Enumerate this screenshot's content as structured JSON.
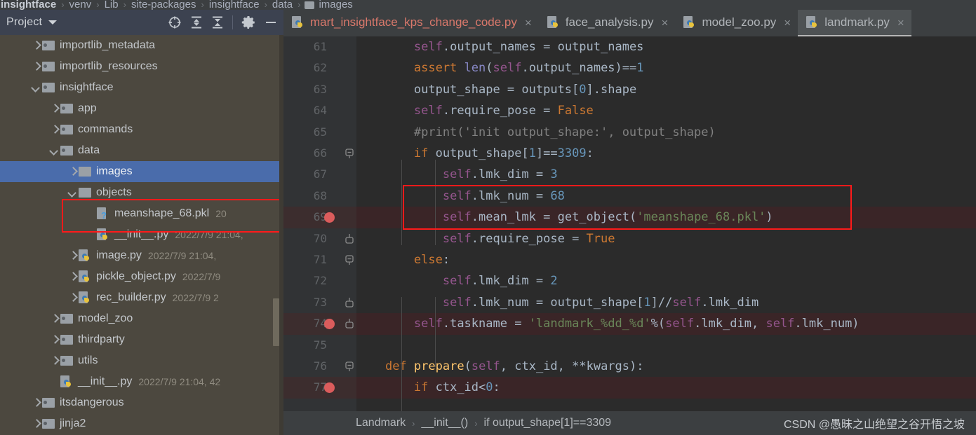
{
  "breadcrumb": {
    "segments": [
      "insightface",
      "venv",
      "Lib",
      "site-packages",
      "insightface",
      "data",
      "images"
    ],
    "separator": "›"
  },
  "project_panel": {
    "title": "Project",
    "toolbar_icons": [
      "locate-icon",
      "expand-all-icon",
      "collapse-all-icon",
      "gear-icon",
      "hide-icon"
    ],
    "tree": [
      {
        "indent": 1,
        "arrow": "right",
        "icon": "folder-icon",
        "label": "importlib_metadata",
        "meta": "",
        "selected": false
      },
      {
        "indent": 1,
        "arrow": "right",
        "icon": "folder-icon",
        "label": "importlib_resources",
        "meta": "",
        "selected": false
      },
      {
        "indent": 1,
        "arrow": "down",
        "icon": "folder-icon",
        "label": "insightface",
        "meta": "",
        "selected": false
      },
      {
        "indent": 2,
        "arrow": "right",
        "icon": "folder-icon",
        "label": "app",
        "meta": "",
        "selected": false
      },
      {
        "indent": 2,
        "arrow": "right",
        "icon": "folder-icon",
        "label": "commands",
        "meta": "",
        "selected": false
      },
      {
        "indent": 2,
        "arrow": "down",
        "icon": "folder-icon",
        "label": "data",
        "meta": "",
        "selected": false
      },
      {
        "indent": 3,
        "arrow": "right",
        "icon": "folder-plain-icon",
        "label": "images",
        "meta": "",
        "selected": true
      },
      {
        "indent": 3,
        "arrow": "down",
        "icon": "folder-plain-icon",
        "label": "objects",
        "meta": "",
        "selected": false
      },
      {
        "indent": 4,
        "arrow": "none",
        "icon": "pkl-file-icon",
        "label": "meanshape_68.pkl",
        "meta": "20",
        "selected": false
      },
      {
        "indent": 4,
        "arrow": "none",
        "icon": "python-file-icon",
        "label": "__init__.py",
        "meta": "2022/7/9 21:04,",
        "selected": false
      },
      {
        "indent": 3,
        "arrow": "right",
        "icon": "python-file-icon",
        "label": "image.py",
        "meta": "2022/7/9 21:04,",
        "selected": false
      },
      {
        "indent": 3,
        "arrow": "right",
        "icon": "python-file-icon",
        "label": "pickle_object.py",
        "meta": "2022/7/9",
        "selected": false
      },
      {
        "indent": 3,
        "arrow": "right",
        "icon": "python-file-icon",
        "label": "rec_builder.py",
        "meta": "2022/7/9 2",
        "selected": false
      },
      {
        "indent": 2,
        "arrow": "right",
        "icon": "folder-icon",
        "label": "model_zoo",
        "meta": "",
        "selected": false
      },
      {
        "indent": 2,
        "arrow": "right",
        "icon": "folder-icon",
        "label": "thirdparty",
        "meta": "",
        "selected": false
      },
      {
        "indent": 2,
        "arrow": "right",
        "icon": "folder-icon",
        "label": "utils",
        "meta": "",
        "selected": false
      },
      {
        "indent": 2,
        "arrow": "none",
        "icon": "python-file-icon",
        "label": "__init__.py",
        "meta": "2022/7/9 21:04, 42",
        "selected": false
      },
      {
        "indent": 1,
        "arrow": "right",
        "icon": "folder-icon",
        "label": "itsdangerous",
        "meta": "",
        "selected": false
      },
      {
        "indent": 1,
        "arrow": "right",
        "icon": "folder-icon",
        "label": "jinja2",
        "meta": "",
        "selected": false
      }
    ]
  },
  "editor": {
    "tabs": [
      {
        "label": "mart_insightface_kps_change_code.py",
        "icon": "python-file-icon",
        "close": "×",
        "active": false,
        "modified": true
      },
      {
        "label": "face_analysis.py",
        "icon": "python-file-icon",
        "close": "×",
        "active": false,
        "modified": false
      },
      {
        "label": "model_zoo.py",
        "icon": "python-file-icon",
        "close": "×",
        "active": false,
        "modified": false
      },
      {
        "label": "landmark.py",
        "icon": "python-file-icon",
        "close": "×",
        "active": true,
        "modified": false
      }
    ],
    "lines": [
      {
        "num": "61",
        "breakpoint": false,
        "highlight": false,
        "fold": "none",
        "tokens": [
          {
            "t": "        ",
            "c": ""
          },
          {
            "t": "self",
            "c": "t-self"
          },
          {
            "t": ".output_names = output_names",
            "c": ""
          }
        ]
      },
      {
        "num": "62",
        "breakpoint": false,
        "highlight": false,
        "fold": "none",
        "tokens": [
          {
            "t": "        ",
            "c": ""
          },
          {
            "t": "assert",
            "c": "t-kw"
          },
          {
            "t": " ",
            "c": ""
          },
          {
            "t": "len",
            "c": "t-builtin"
          },
          {
            "t": "(",
            "c": ""
          },
          {
            "t": "self",
            "c": "t-self"
          },
          {
            "t": ".output_names)==",
            "c": ""
          },
          {
            "t": "1",
            "c": "t-num"
          }
        ]
      },
      {
        "num": "63",
        "breakpoint": false,
        "highlight": false,
        "fold": "none",
        "tokens": [
          {
            "t": "        output_shape = outputs[",
            "c": ""
          },
          {
            "t": "0",
            "c": "t-num"
          },
          {
            "t": "].shape",
            "c": ""
          }
        ]
      },
      {
        "num": "64",
        "breakpoint": false,
        "highlight": false,
        "fold": "none",
        "tokens": [
          {
            "t": "        ",
            "c": ""
          },
          {
            "t": "self",
            "c": "t-self"
          },
          {
            "t": ".require_pose = ",
            "c": ""
          },
          {
            "t": "False",
            "c": "t-kw"
          }
        ]
      },
      {
        "num": "65",
        "breakpoint": false,
        "highlight": false,
        "fold": "none",
        "tokens": [
          {
            "t": "        #print('init output_shape:', output_shape)",
            "c": "t-cmt"
          }
        ]
      },
      {
        "num": "66",
        "breakpoint": false,
        "highlight": false,
        "fold": "open",
        "tokens": [
          {
            "t": "        ",
            "c": ""
          },
          {
            "t": "if",
            "c": "t-kw"
          },
          {
            "t": " output_shape[",
            "c": ""
          },
          {
            "t": "1",
            "c": "t-num"
          },
          {
            "t": "]==",
            "c": ""
          },
          {
            "t": "3309",
            "c": "t-num"
          },
          {
            "t": ":",
            "c": ""
          }
        ]
      },
      {
        "num": "67",
        "breakpoint": false,
        "highlight": false,
        "fold": "none",
        "tokens": [
          {
            "t": "            ",
            "c": ""
          },
          {
            "t": "self",
            "c": "t-self"
          },
          {
            "t": ".lmk_dim = ",
            "c": ""
          },
          {
            "t": "3",
            "c": "t-num"
          }
        ]
      },
      {
        "num": "68",
        "breakpoint": false,
        "highlight": false,
        "fold": "none",
        "tokens": [
          {
            "t": "            ",
            "c": ""
          },
          {
            "t": "self",
            "c": "t-self"
          },
          {
            "t": ".lmk_num = ",
            "c": ""
          },
          {
            "t": "68",
            "c": "t-num"
          }
        ]
      },
      {
        "num": "69",
        "breakpoint": true,
        "highlight": true,
        "fold": "none",
        "tokens": [
          {
            "t": "            ",
            "c": ""
          },
          {
            "t": "self",
            "c": "t-self"
          },
          {
            "t": ".mean_lmk = get_object(",
            "c": ""
          },
          {
            "t": "'meanshape_68.pkl'",
            "c": "t-str"
          },
          {
            "t": ")",
            "c": ""
          }
        ]
      },
      {
        "num": "70",
        "breakpoint": false,
        "highlight": false,
        "fold": "close",
        "tokens": [
          {
            "t": "            ",
            "c": ""
          },
          {
            "t": "self",
            "c": "t-self"
          },
          {
            "t": ".require_pose = ",
            "c": ""
          },
          {
            "t": "True",
            "c": "t-kw"
          }
        ]
      },
      {
        "num": "71",
        "breakpoint": false,
        "highlight": false,
        "fold": "open",
        "tokens": [
          {
            "t": "        ",
            "c": ""
          },
          {
            "t": "else",
            "c": "t-kw"
          },
          {
            "t": ":",
            "c": ""
          }
        ]
      },
      {
        "num": "72",
        "breakpoint": false,
        "highlight": false,
        "fold": "none",
        "tokens": [
          {
            "t": "            ",
            "c": ""
          },
          {
            "t": "self",
            "c": "t-self"
          },
          {
            "t": ".lmk_dim = ",
            "c": ""
          },
          {
            "t": "2",
            "c": "t-num"
          }
        ]
      },
      {
        "num": "73",
        "breakpoint": false,
        "highlight": false,
        "fold": "close",
        "tokens": [
          {
            "t": "            ",
            "c": ""
          },
          {
            "t": "self",
            "c": "t-self"
          },
          {
            "t": ".lmk_num = output_shape[",
            "c": ""
          },
          {
            "t": "1",
            "c": "t-num"
          },
          {
            "t": "]//",
            "c": ""
          },
          {
            "t": "self",
            "c": "t-self"
          },
          {
            "t": ".lmk_dim",
            "c": ""
          }
        ]
      },
      {
        "num": "74",
        "breakpoint": true,
        "highlight": true,
        "fold": "close",
        "tokens": [
          {
            "t": "        ",
            "c": ""
          },
          {
            "t": "self",
            "c": "t-self"
          },
          {
            "t": ".taskname = ",
            "c": ""
          },
          {
            "t": "'landmark_%dd_%d'",
            "c": "t-str"
          },
          {
            "t": "%(",
            "c": ""
          },
          {
            "t": "self",
            "c": "t-self"
          },
          {
            "t": ".lmk_dim, ",
            "c": ""
          },
          {
            "t": "self",
            "c": "t-self"
          },
          {
            "t": ".lmk_num)",
            "c": ""
          }
        ]
      },
      {
        "num": "75",
        "breakpoint": false,
        "highlight": false,
        "fold": "none",
        "tokens": [
          {
            "t": "",
            "c": ""
          }
        ]
      },
      {
        "num": "76",
        "breakpoint": false,
        "highlight": false,
        "fold": "open",
        "tokens": [
          {
            "t": "    ",
            "c": ""
          },
          {
            "t": "def",
            "c": "t-kw"
          },
          {
            "t": " ",
            "c": ""
          },
          {
            "t": "prepare",
            "c": "t-fn"
          },
          {
            "t": "(",
            "c": ""
          },
          {
            "t": "self",
            "c": "t-self"
          },
          {
            "t": ", ctx_id, **kwargs):",
            "c": ""
          }
        ]
      },
      {
        "num": "77",
        "breakpoint": true,
        "highlight": true,
        "fold": "none",
        "tokens": [
          {
            "t": "        ",
            "c": ""
          },
          {
            "t": "if",
            "c": "t-kw"
          },
          {
            "t": " ctx_id<",
            "c": ""
          },
          {
            "t": "0",
            "c": "t-num"
          },
          {
            "t": ":",
            "c": ""
          }
        ]
      }
    ]
  },
  "statusbar": {
    "crumbs": [
      "Landmark",
      "__init__()",
      "if output_shape[1]==3309"
    ],
    "separator": "›",
    "watermark": "CSDN @愚昧之山绝望之谷开悟之坡"
  },
  "annotations": {
    "tree_box_color": "#ff1a1a",
    "code_box_color": "#ff1a1a"
  },
  "colors": {
    "selection_blue": "#4a6cab",
    "sidebar_bg": "#4c483f",
    "editor_bg": "#2b2b2b",
    "highlight_line": "#3a2527",
    "breakpoint": "#db5c5c"
  }
}
